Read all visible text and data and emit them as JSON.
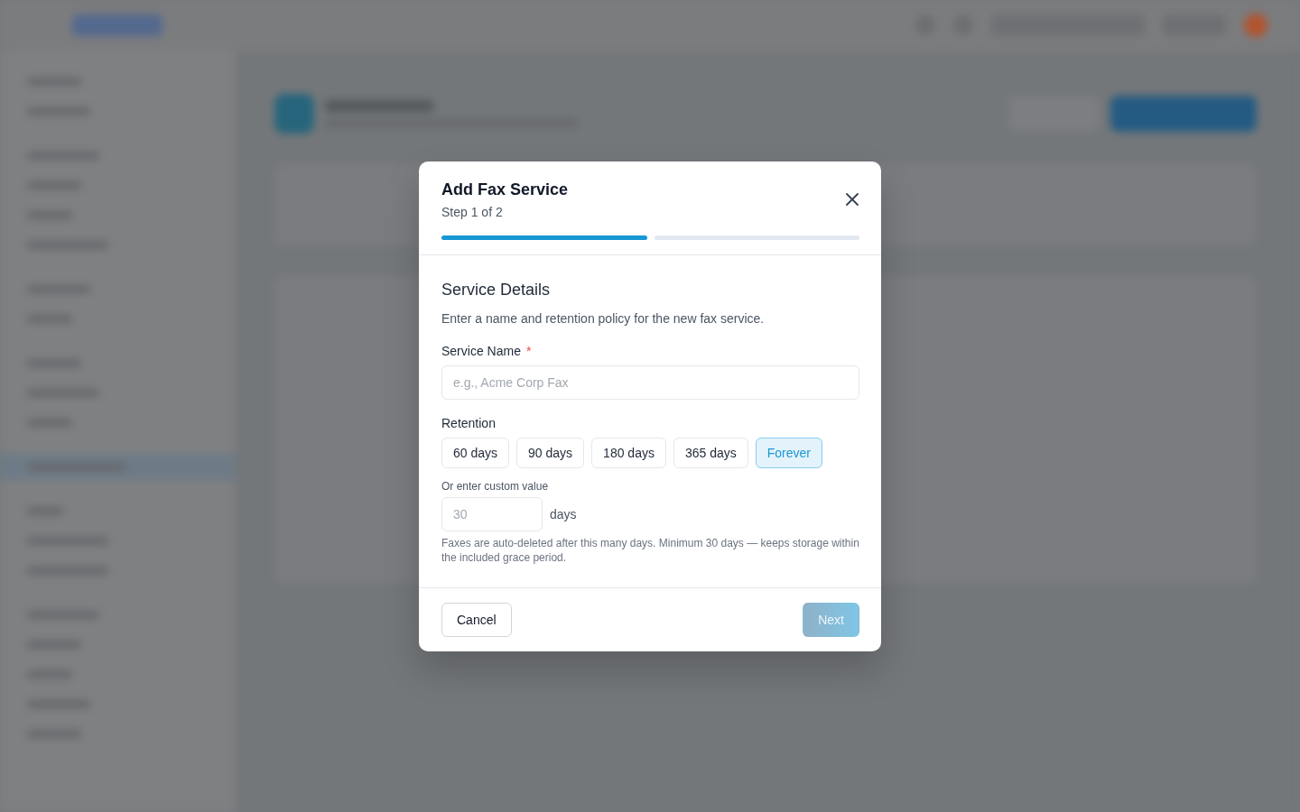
{
  "dialog": {
    "title": "Add Fax Service",
    "subtitle": "Step 1 of 2",
    "steps": [
      {
        "complete": true
      },
      {
        "complete": false
      }
    ],
    "section": {
      "title": "Service Details",
      "description": "Enter a name and retention policy for the new fax service."
    },
    "service_name": {
      "label": "Service Name",
      "required_mark": "*",
      "placeholder": "e.g., Acme Corp Fax"
    },
    "retention": {
      "label": "Retention",
      "options": [
        {
          "label": "60 days",
          "selected": false
        },
        {
          "label": "90 days",
          "selected": false
        },
        {
          "label": "180 days",
          "selected": false
        },
        {
          "label": "365 days",
          "selected": false
        },
        {
          "label": "Forever",
          "selected": true
        }
      ],
      "custom": {
        "label": "Or enter custom value",
        "placeholder": "30",
        "unit": "days"
      },
      "help": "Faxes are auto-deleted after this many days. Minimum 30 days — keeps storage within the included grace period."
    },
    "buttons": [
      {
        "kind": "secondary",
        "label": "Cancel",
        "disabled": false
      },
      {
        "kind": "primary",
        "label": "Next",
        "disabled": true
      }
    ]
  }
}
